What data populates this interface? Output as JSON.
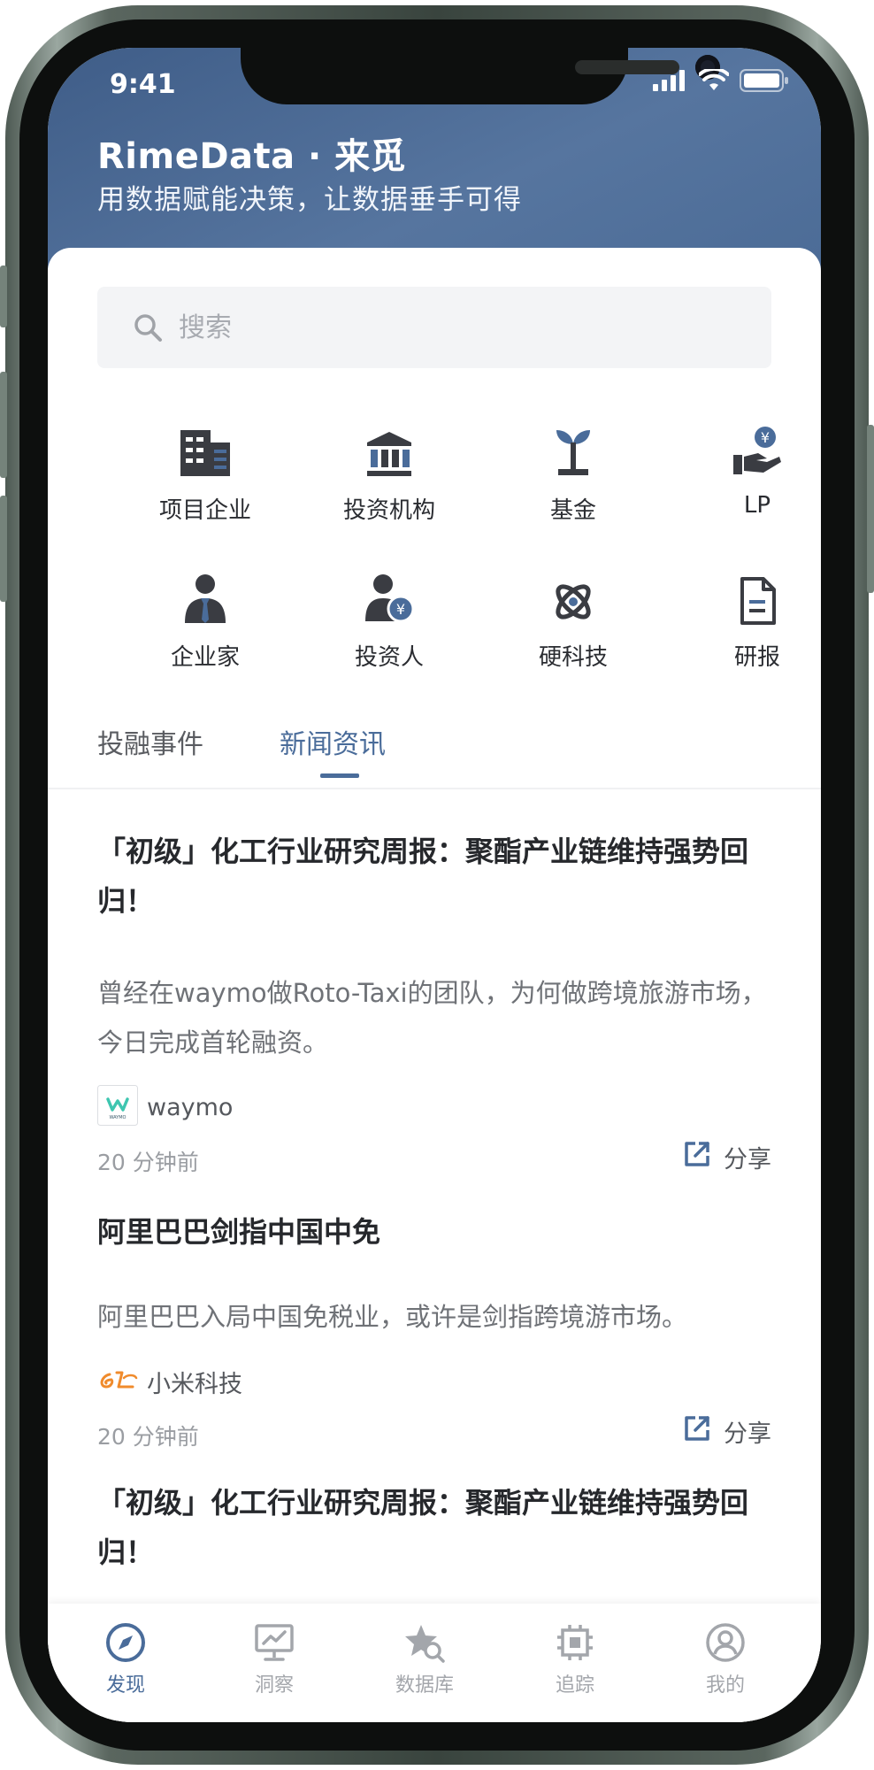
{
  "status_bar": {
    "time": "9:41"
  },
  "header": {
    "title": "RimeData · 来觅",
    "subtitle": "用数据赋能决策，让数据垂手可得"
  },
  "search": {
    "placeholder": "搜索"
  },
  "categories": [
    {
      "label": "项目企业",
      "icon": "building-icon"
    },
    {
      "label": "投资机构",
      "icon": "bank-icon"
    },
    {
      "label": "基金",
      "icon": "sprout-icon"
    },
    {
      "label": "LP",
      "icon": "hand-yen-icon"
    },
    {
      "label": "企业家",
      "icon": "businessman-icon"
    },
    {
      "label": "投资人",
      "icon": "investor-yen-icon"
    },
    {
      "label": "硬科技",
      "icon": "atom-icon"
    },
    {
      "label": "研报",
      "icon": "document-icon"
    }
  ],
  "content_tabs": [
    {
      "label": "投融事件",
      "active": false
    },
    {
      "label": "新闻资讯",
      "active": true
    }
  ],
  "news": [
    {
      "title": "「初级」化工行业研究周报：聚酯产业链维持强势回归！",
      "desc": "曾经在waymo做Roto-Taxi的团队，为何做跨境旅游市场，今日完成首轮融资。",
      "source": "waymo",
      "logo_text": "WAYMO",
      "time": "20 分钟前",
      "share": "分享"
    },
    {
      "title": "阿里巴巴剑指中国中免",
      "desc": "阿里巴巴入局中国免税业，或许是剑指跨境游市场。",
      "source": "小米科技",
      "time": "20 分钟前",
      "share": "分享"
    },
    {
      "title": "「初级」化工行业研究周报：聚酯产业链维持强势回归！"
    }
  ],
  "tabbar": [
    {
      "label": "发现",
      "icon": "compass-icon",
      "active": true
    },
    {
      "label": "洞察",
      "icon": "monitor-chart-icon",
      "active": false
    },
    {
      "label": "数据库",
      "icon": "star-search-icon",
      "active": false
    },
    {
      "label": "追踪",
      "icon": "track-icon",
      "active": false
    },
    {
      "label": "我的",
      "icon": "user-icon",
      "active": false
    }
  ],
  "colors": {
    "accent": "#4a6c9a",
    "header_gradient_start": "#3f5d88",
    "header_gradient_end": "#56759f",
    "icon_dark": "#3a3c42",
    "inactive_gray": "#a3a6ab"
  }
}
